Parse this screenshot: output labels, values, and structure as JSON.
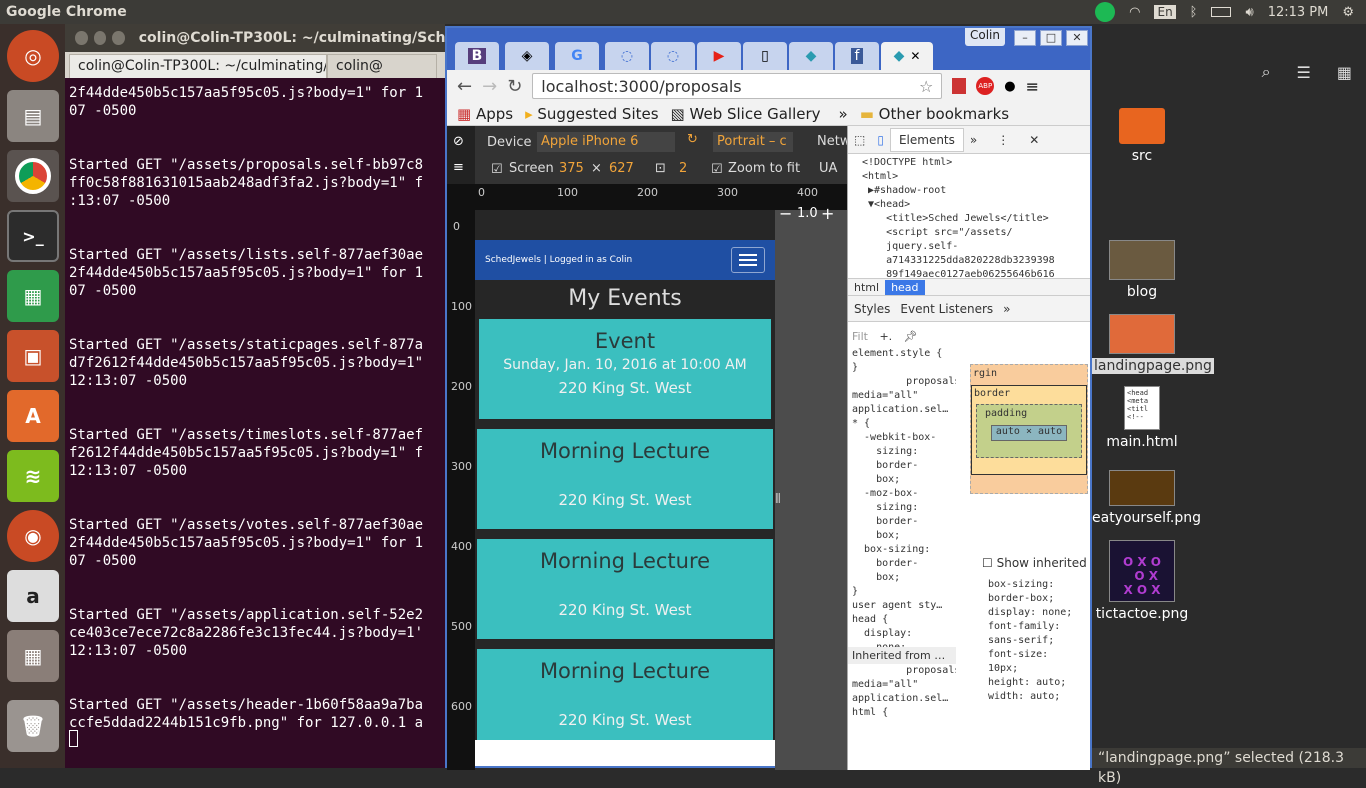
{
  "topbar": {
    "app_name": "Google Chrome",
    "input_method": "En",
    "clock": "12:13 PM"
  },
  "terminal": {
    "window_title": "colin@Colin-TP300L: ~/culminating/SchedJe",
    "tab1": "colin@Colin-TP300L: ~/culminating/Sche...",
    "tab2": "colin@",
    "lines": "2f44dde450b5c157aa5f95c05.js?body=1\" for 1\n07 -0500\n\n\nStarted GET \"/assets/proposals.self-bb97c8\nff0c58f881631015aab248adf3fa2.js?body=1\" f\n:13:07 -0500\n\n\nStarted GET \"/assets/lists.self-877aef30ae\n2f44dde450b5c157aa5f95c05.js?body=1\" for 1\n07 -0500\n\n\nStarted GET \"/assets/staticpages.self-877a\nd7f2612f44dde450b5c157aa5f95c05.js?body=1\"\n12:13:07 -0500\n\n\nStarted GET \"/assets/timeslots.self-877aef\nf2612f44dde450b5c157aa5f95c05.js?body=1\" f\n12:13:07 -0500\n\n\nStarted GET \"/assets/votes.self-877aef30ae\n2f44dde450b5c157aa5f95c05.js?body=1\" for 1\n07 -0500\n\n\nStarted GET \"/assets/application.self-52e2\nce403ce7ece72c8a2286fe3c13fec44.js?body=1'\n12:13:07 -0500\n\n\nStarted GET \"/assets/header-1b60f58aa9a7ba\nccfe5ddad2244b151c9fb.png\" for 127.0.0.1 a"
  },
  "chrome": {
    "user": "Colin",
    "url": "localhost:3000/proposals",
    "bookmarks": [
      "Apps",
      "Suggested Sites",
      "Web Slice Gallery",
      "»",
      "Other bookmarks"
    ],
    "tab_letters": [
      "B",
      "",
      "G",
      "",
      "",
      "",
      "",
      "",
      "f",
      ""
    ]
  },
  "device": {
    "device_label": "Device",
    "device_value": "Apple iPhone 6",
    "orientation": "Portrait – c",
    "network_label": "Netw",
    "screen_label": "Screen",
    "screen_w": "375",
    "screen_x": "×",
    "screen_h": "627",
    "dpr": "2",
    "zoom_label": "Zoom to fit",
    "ua_label": "UA",
    "zoom_value": "1.0",
    "ruler_top": [
      "0",
      "100",
      "200",
      "300",
      "400"
    ],
    "ruler_left": [
      "0",
      "100",
      "200",
      "300",
      "400",
      "500",
      "600"
    ]
  },
  "app": {
    "brand": "SchedJewels | Logged in as Colin",
    "page_title": "My Events",
    "events": [
      {
        "name": "Event",
        "date": "Sunday, Jan. 10, 2016 at 10:00 AM",
        "place": "220 King St. West"
      },
      {
        "name": "Morning Lecture",
        "date": "",
        "place": "220 King St. West"
      },
      {
        "name": "Morning Lecture",
        "date": "",
        "place": "220 King St. West"
      },
      {
        "name": "Morning Lecture",
        "date": "",
        "place": "220 King St. West"
      }
    ]
  },
  "devtools": {
    "elements_tab": "Elements",
    "html_source": "<!DOCTYPE html>\n<html>\n ▶#shadow-root\n ▼<head>\n    <title>Sched Jewels</title>\n    <script src=\"/assets/\n    jquery.self-\n    a714331225dda820228db3239398\n    89f149aec0127aeb06255646b616\n    balca419.js?body=1\" data-",
    "crumbs": [
      "html",
      "head"
    ],
    "styles_tab": "Styles",
    "listeners_tab": "Event Listeners",
    "filter_placeholder": "Filt",
    "styles_text": "element.style {\n}\n         proposals\nmedia=\"all\"\napplication.sel…\n* {\n  -webkit-box-\n    sizing:\n    border-\n    box;\n  -moz-box-\n    sizing:\n    border-\n    box;\n  box-sizing:\n    border-\n    box;\n}\nuser agent sty…\nhead {\n  display:\n    none;\n}",
    "inherited": "Inherited from …",
    "inherited_text": "         proposals\nmedia=\"all\"\napplication.sel…\nhtml {",
    "boxmodel_margin": "rgin",
    "boxmodel_border": "border",
    "boxmodel_padding": "padding",
    "boxmodel_content": "auto × auto",
    "boxmodel_dash": "–",
    "show_inherited": "Show inherited",
    "computed_text": "box-sizing:\nborder-box;\ndisplay: none;\nfont-family:\nsans-serif;\nfont-size:\n10px;\nheight: auto;\nwidth: auto;"
  },
  "desktop": {
    "icons": [
      {
        "label": "src"
      },
      {
        "label": "blog"
      },
      {
        "label": "landingpage.png"
      },
      {
        "label": "main.html"
      },
      {
        "label": "eatyourself.png"
      },
      {
        "label": "tictactoe.png"
      }
    ],
    "main_html_preview": "<head\n<meta\n<titl\n<!--",
    "status": "“landingpage.png” selected  (218.3 kB)"
  }
}
